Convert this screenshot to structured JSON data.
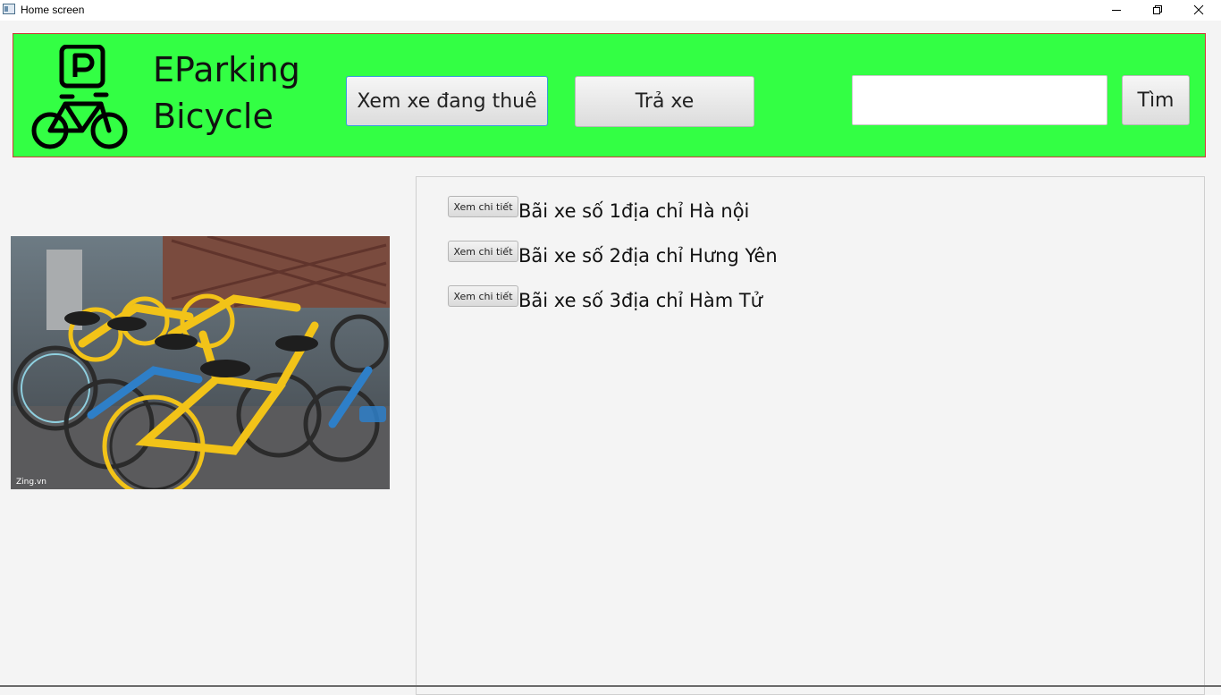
{
  "window": {
    "title": "Home screen"
  },
  "header": {
    "brand_line1": "EParking",
    "brand_line2": "Bicycle",
    "rented_button": "Xem xe đang thuê",
    "return_button": "Trả xe",
    "search_value": "",
    "search_button": "Tìm",
    "background_color": "#33ff44",
    "border_color": "#d03a3a"
  },
  "lots": [
    {
      "button": "Xem chi tiết",
      "label": "Bãi xe số 1địa chỉ Hà nội"
    },
    {
      "button": "Xem chi tiết",
      "label": "Bãi xe số 2địa chỉ Hưng Yên"
    },
    {
      "button": "Xem chi tiết",
      "label": "Bãi xe số 3địa chỉ Hàm Tử"
    }
  ],
  "photo": {
    "watermark": "Zing.vn"
  }
}
